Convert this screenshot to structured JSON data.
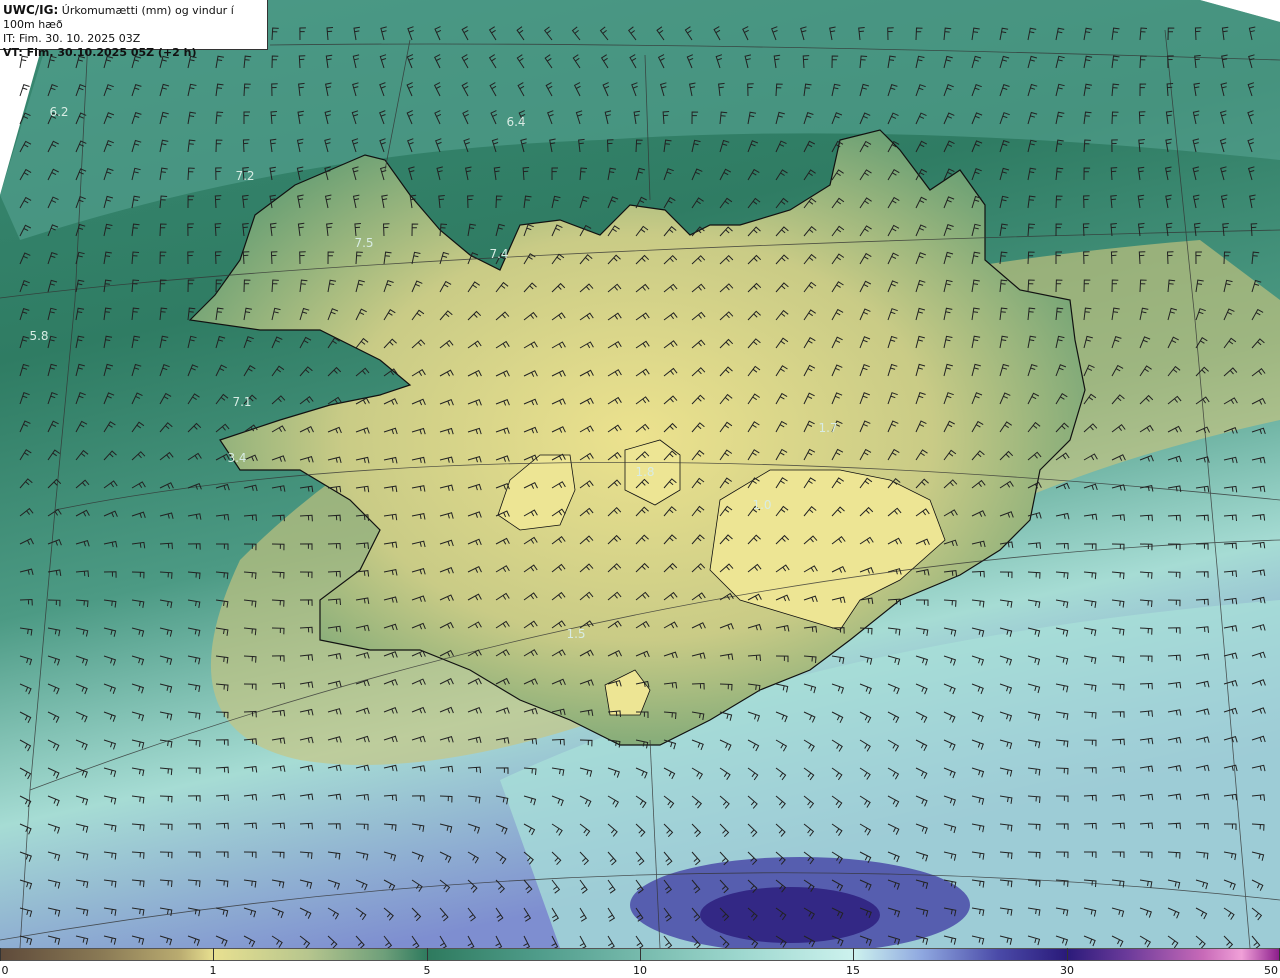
{
  "header": {
    "product": "UWC/IG:",
    "description": "Úrkomumætti (mm) og vindur í 100m hæð",
    "init_time": "IT: Fim. 30. 10. 2025 03Z",
    "valid_time": "VT: Fim. 30.10.2025 05Z (+2 h)"
  },
  "colorbar": {
    "ticks": [
      {
        "label": "0",
        "pos": 0.0
      },
      {
        "label": "1",
        "pos": 0.1667
      },
      {
        "label": "5",
        "pos": 0.3335
      },
      {
        "label": "10",
        "pos": 0.5
      },
      {
        "label": "15",
        "pos": 0.6667
      },
      {
        "label": "30",
        "pos": 0.8333
      },
      {
        "label": "50",
        "pos": 1.0
      }
    ]
  },
  "map_labels": [
    {
      "text": "6.2"
    },
    {
      "text": "6.4"
    },
    {
      "text": "7.2"
    },
    {
      "text": "7.5"
    },
    {
      "text": "7.4"
    },
    {
      "text": "5.8"
    },
    {
      "text": "7.1"
    },
    {
      "text": "3.4"
    },
    {
      "text": "1.7"
    },
    {
      "text": "1.8"
    },
    {
      "text": "1.0"
    },
    {
      "text": "1.5"
    }
  ],
  "colors": {
    "low": "#e8e090",
    "mid": "#2e7a5e",
    "high": "#cdf2ee",
    "heavy": "#2a1a7a"
  }
}
